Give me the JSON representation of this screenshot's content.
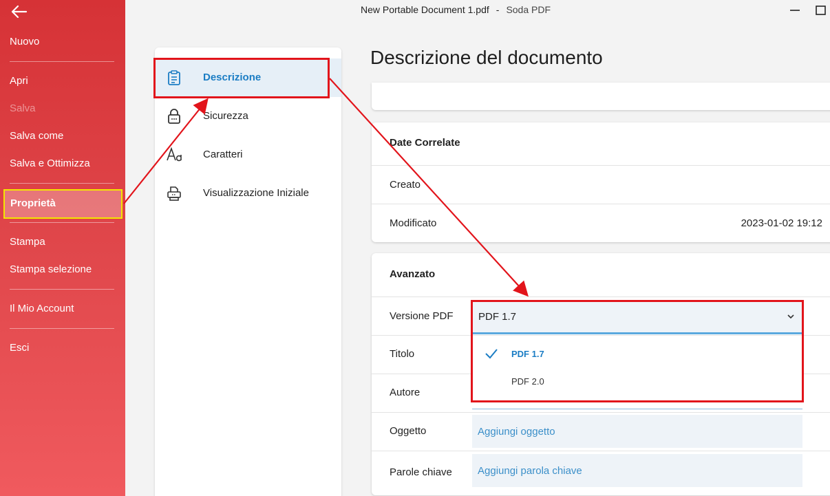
{
  "window": {
    "document_name": "New Portable Document 1.pdf",
    "separator": "-",
    "app_name": "Soda PDF"
  },
  "sidebar": {
    "items": [
      {
        "label": "Nuovo",
        "enabled": true
      },
      {
        "label": "Apri",
        "enabled": true
      },
      {
        "label": "Salva",
        "enabled": false
      },
      {
        "label": "Salva come",
        "enabled": true
      },
      {
        "label": "Salva e Ottimizza",
        "enabled": true
      },
      {
        "label": "Proprietà",
        "enabled": true,
        "active": true
      },
      {
        "label": "Stampa",
        "enabled": true
      },
      {
        "label": "Stampa selezione",
        "enabled": true
      },
      {
        "label": "Il Mio Account",
        "enabled": true
      },
      {
        "label": "Esci",
        "enabled": true
      }
    ]
  },
  "properties_nav": {
    "items": [
      {
        "label": "Descrizione",
        "icon": "clipboard-icon",
        "active": true
      },
      {
        "label": "Sicurezza",
        "icon": "lock-icon"
      },
      {
        "label": "Caratteri",
        "icon": "font-icon"
      },
      {
        "label": "Visualizzazione Iniziale",
        "icon": "printer-icon"
      }
    ]
  },
  "main": {
    "title": "Descrizione del documento",
    "dates": {
      "heading": "Date Correlate",
      "created_label": "Creato",
      "created_value": "",
      "modified_label": "Modificato",
      "modified_value": "2023-01-02 19:12"
    },
    "advanced": {
      "heading": "Avanzato",
      "pdf_version_label": "Versione PDF",
      "pdf_version_value": "PDF 1.7",
      "pdf_version_options": [
        "PDF 1.7",
        "PDF 2.0"
      ],
      "title_label": "Titolo",
      "author_label": "Autore",
      "subject_label": "Oggetto",
      "subject_placeholder": "Aggiungi oggetto",
      "keywords_label": "Parole chiave",
      "keywords_placeholder": "Aggiungi parola chiave"
    }
  },
  "colors": {
    "sidebar_red": "#d63236",
    "accent_blue": "#1b7dc4",
    "annotation_red": "#e2141b",
    "annotation_yellow": "#f3e600"
  }
}
